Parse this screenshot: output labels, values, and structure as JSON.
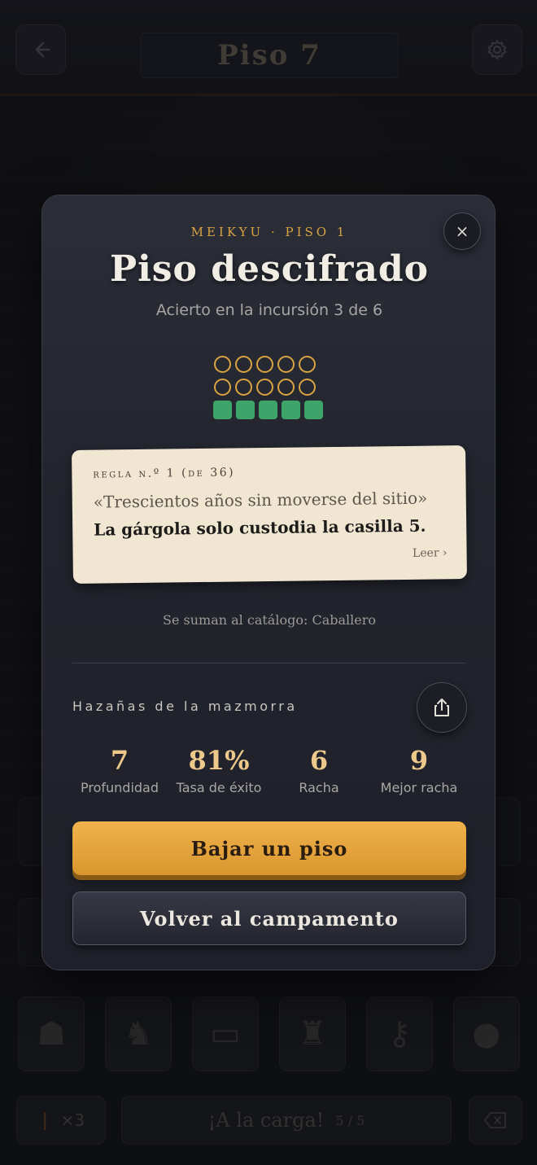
{
  "header": {
    "title": "Piso 7",
    "back_icon": "arrow-left-icon",
    "settings_icon": "gear-icon"
  },
  "bottom": {
    "items": [
      "ghost",
      "beast",
      "chest",
      "lantern",
      "key",
      "coins"
    ],
    "torch_count": "×3",
    "charge_label": "¡A la carga!",
    "charge_count": "5 / 5",
    "delete_icon": "backspace-icon"
  },
  "modal": {
    "eyebrow": "MEIKYU · PISO 1",
    "title": "Piso descifrado",
    "subtitle": "Acierto en la incursión 3 de 6",
    "grid": {
      "rows": [
        [
          "empty",
          "empty",
          "empty",
          "empty",
          "empty"
        ],
        [
          "empty",
          "empty",
          "empty",
          "empty",
          "empty"
        ],
        [
          "hit",
          "hit",
          "hit",
          "hit",
          "hit"
        ]
      ],
      "hit_color": "#3fa46a",
      "ring_color": "#d9a441"
    },
    "rule": {
      "label": "regla n.º 1 (de 36)",
      "quote": "«Trescientos años sin moverse del sitio»",
      "text": "La gárgola solo custodia la casilla 5.",
      "more": "Leer ›"
    },
    "catalog": "Se suman al catálogo: Caballero",
    "feats_title": "Hazañas de la mazmorra",
    "stats": [
      {
        "value": "7",
        "label": "Profundidad"
      },
      {
        "value": "81%",
        "label": "Tasa de éxito"
      },
      {
        "value": "6",
        "label": "Racha"
      },
      {
        "value": "9",
        "label": "Mejor racha"
      }
    ],
    "primary_button": "Bajar un piso",
    "secondary_button": "Volver al campamento",
    "close_label": "×"
  }
}
